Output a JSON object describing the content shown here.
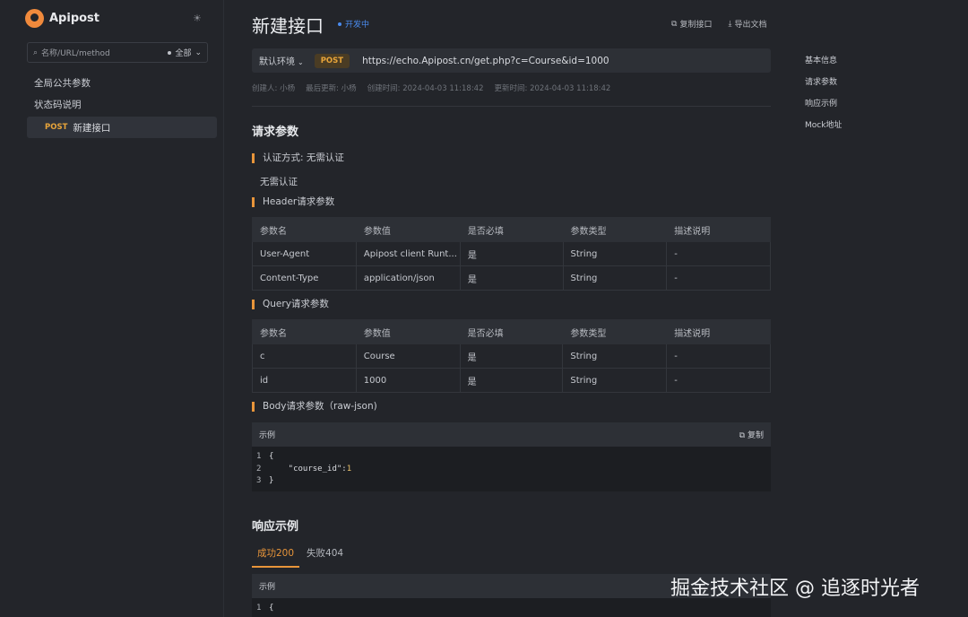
{
  "sidebar": {
    "logo_text": "Apipost",
    "search_placeholder": "名称/URL/method",
    "filter_label": "全部",
    "items": [
      {
        "label": "全局公共参数"
      },
      {
        "label": "状态码说明"
      }
    ],
    "active_item": {
      "method": "POST",
      "label": "新建接口"
    }
  },
  "header": {
    "title": "新建接口",
    "status": "开发中",
    "copy_label": "复制接口",
    "export_label": "导出文档"
  },
  "url_bar": {
    "env": "默认环境",
    "method": "POST",
    "url": "https://echo.Apipost.cn/get.php?c=Course&id=1000"
  },
  "meta": {
    "creator": "创建人: 小杨",
    "updated_by": "最后更新: 小杨",
    "created_at": "创建时间: 2024-04-03 11:18:42",
    "updated_at": "更新时间: 2024-04-03 11:18:42"
  },
  "request": {
    "heading": "请求参数",
    "auth_label": "认证方式: ",
    "auth_value": "无需认证",
    "auth_plain": "无需认证",
    "header_heading": "Header请求参数",
    "query_heading": "Query请求参数",
    "body_heading": "Body请求参数（raw-json)",
    "columns": [
      "参数名",
      "参数值",
      "是否必填",
      "参数类型",
      "描述说明"
    ],
    "header_rows": [
      [
        "User-Agent",
        "Apipost client Runt...",
        "是",
        "String",
        "-"
      ],
      [
        "Content-Type",
        "application/json",
        "是",
        "String",
        "-"
      ]
    ],
    "query_rows": [
      [
        "c",
        "Course",
        "是",
        "String",
        "-"
      ],
      [
        "id",
        "1000",
        "是",
        "String",
        "-"
      ]
    ],
    "example_label": "示例",
    "copy_label": "复制",
    "code": {
      "l1": "1",
      "t1": "{",
      "l2": "2",
      "t2_key": "    \"course_id\":",
      "t2_val": "1",
      "l3": "3",
      "t3": "}"
    }
  },
  "response": {
    "heading": "响应示例",
    "tabs": [
      "成功200",
      "失败404"
    ],
    "example_label": "示例",
    "code_l1": "1",
    "code_t1": "{"
  },
  "anchors": [
    "基本信息",
    "请求参数",
    "响应示例",
    "Mock地址"
  ],
  "watermark": "掘金技术社区 @ 追逐时光者"
}
